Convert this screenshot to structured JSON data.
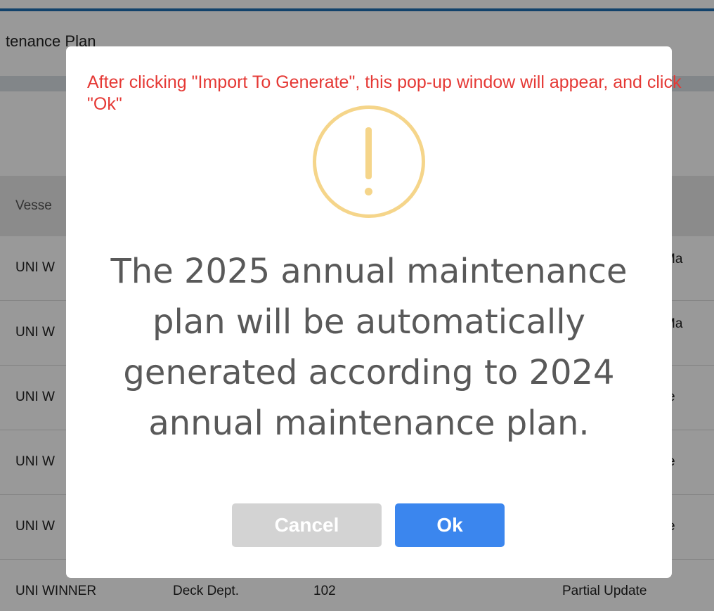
{
  "page": {
    "title": "tenance Plan",
    "table": {
      "header_first_col": "Vesse",
      "rows": [
        {
          "c1": "UNI W",
          "c2": "",
          "c3": "",
          "c4": "Ma"
        },
        {
          "c1": "UNI W",
          "c2": "",
          "c3": "",
          "c4": "Ma"
        },
        {
          "c1": "UNI W",
          "c2": "",
          "c3": "",
          "c4": "e"
        },
        {
          "c1": "UNI W",
          "c2": "",
          "c3": "",
          "c4": "e"
        },
        {
          "c1": "UNI W",
          "c2": "",
          "c3": "",
          "c4": "e"
        },
        {
          "c1": "UNI WINNER",
          "c2": "Deck Dept.",
          "c3": "102",
          "c4": "Partial Update"
        }
      ]
    }
  },
  "dialog": {
    "annotation": "After clicking \"Import To Generate\", this pop-up window will appear, and click \"Ok\"",
    "icon": "warning-exclamation-icon",
    "message": "The 2025 annual maintenance plan will be automatically generated according to 2024 annual maintenance plan.",
    "cancel_label": "Cancel",
    "ok_label": "Ok"
  },
  "colors": {
    "accent": "#3b86ee",
    "warning": "#f5d58a",
    "annotation": "#e53935",
    "cancel": "#d3d3d3"
  }
}
